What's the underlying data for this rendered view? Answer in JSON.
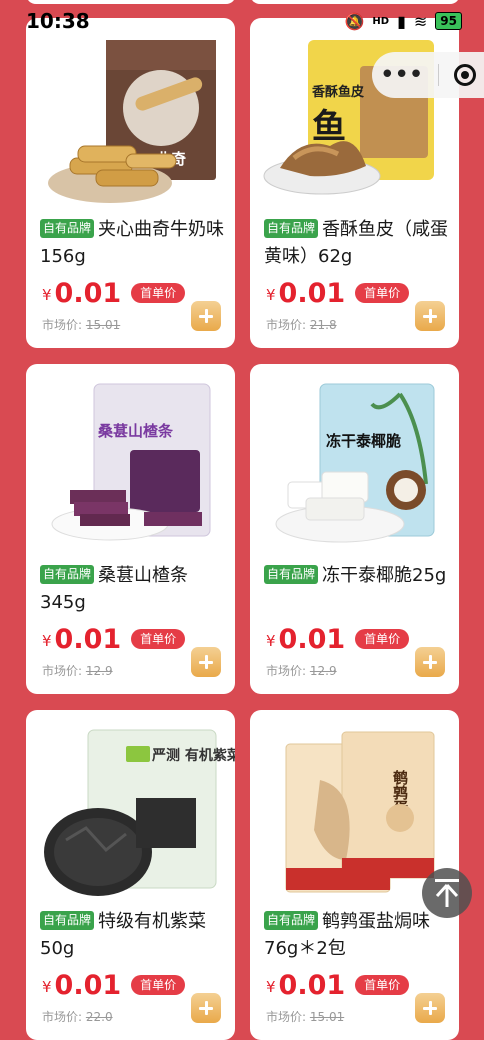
{
  "status_bar": {
    "time": "10:38",
    "network": "HD",
    "battery": "95"
  },
  "capsule": {
    "more": "•••",
    "more_icon": "more-dots-icon",
    "close_icon": "target-close-icon"
  },
  "products": [
    {
      "brand": "自有品牌",
      "name": "夹心曲奇牛奶味156g",
      "currency": "¥",
      "price": "0.01",
      "tag": "首单价",
      "market_label": "市场价:",
      "market_price": "15.01",
      "pack_text": "曲奇"
    },
    {
      "brand": "自有品牌",
      "name": "香酥鱼皮（咸蛋黄味）62g",
      "currency": "¥",
      "price": "0.01",
      "tag": "首单价",
      "market_label": "市场价:",
      "market_price": "21.8",
      "pack_text": "香酥鱼皮"
    },
    {
      "brand": "自有品牌",
      "name": "桑葚山楂条345g",
      "currency": "¥",
      "price": "0.01",
      "tag": "首单价",
      "market_label": "市场价:",
      "market_price": "12.9",
      "pack_text": "桑葚山楂条"
    },
    {
      "brand": "自有品牌",
      "name": "冻干泰椰脆25g",
      "currency": "¥",
      "price": "0.01",
      "tag": "首单价",
      "market_label": "市场价:",
      "market_price": "12.9",
      "pack_text": "冻干泰椰脆"
    },
    {
      "brand": "自有品牌",
      "name": "特级有机紫菜50g",
      "currency": "¥",
      "price": "0.01",
      "tag": "首单价",
      "market_label": "市场价:",
      "market_price": "22.0",
      "pack_text": "严测 有机紫菜"
    },
    {
      "brand": "自有品牌",
      "name": "鹌鹑蛋盐焗味76g＊2包",
      "currency": "¥",
      "price": "0.01",
      "tag": "首单价",
      "market_label": "市场价:",
      "market_price": "15.01",
      "pack_text": "鹌鹑蛋"
    }
  ],
  "back_to_top_icon": "back-to-top-icon",
  "colors": {
    "background": "#d94a52",
    "price": "#e4222e",
    "brand_tag": "#3aa34b",
    "add_button": "#e9a94a"
  }
}
